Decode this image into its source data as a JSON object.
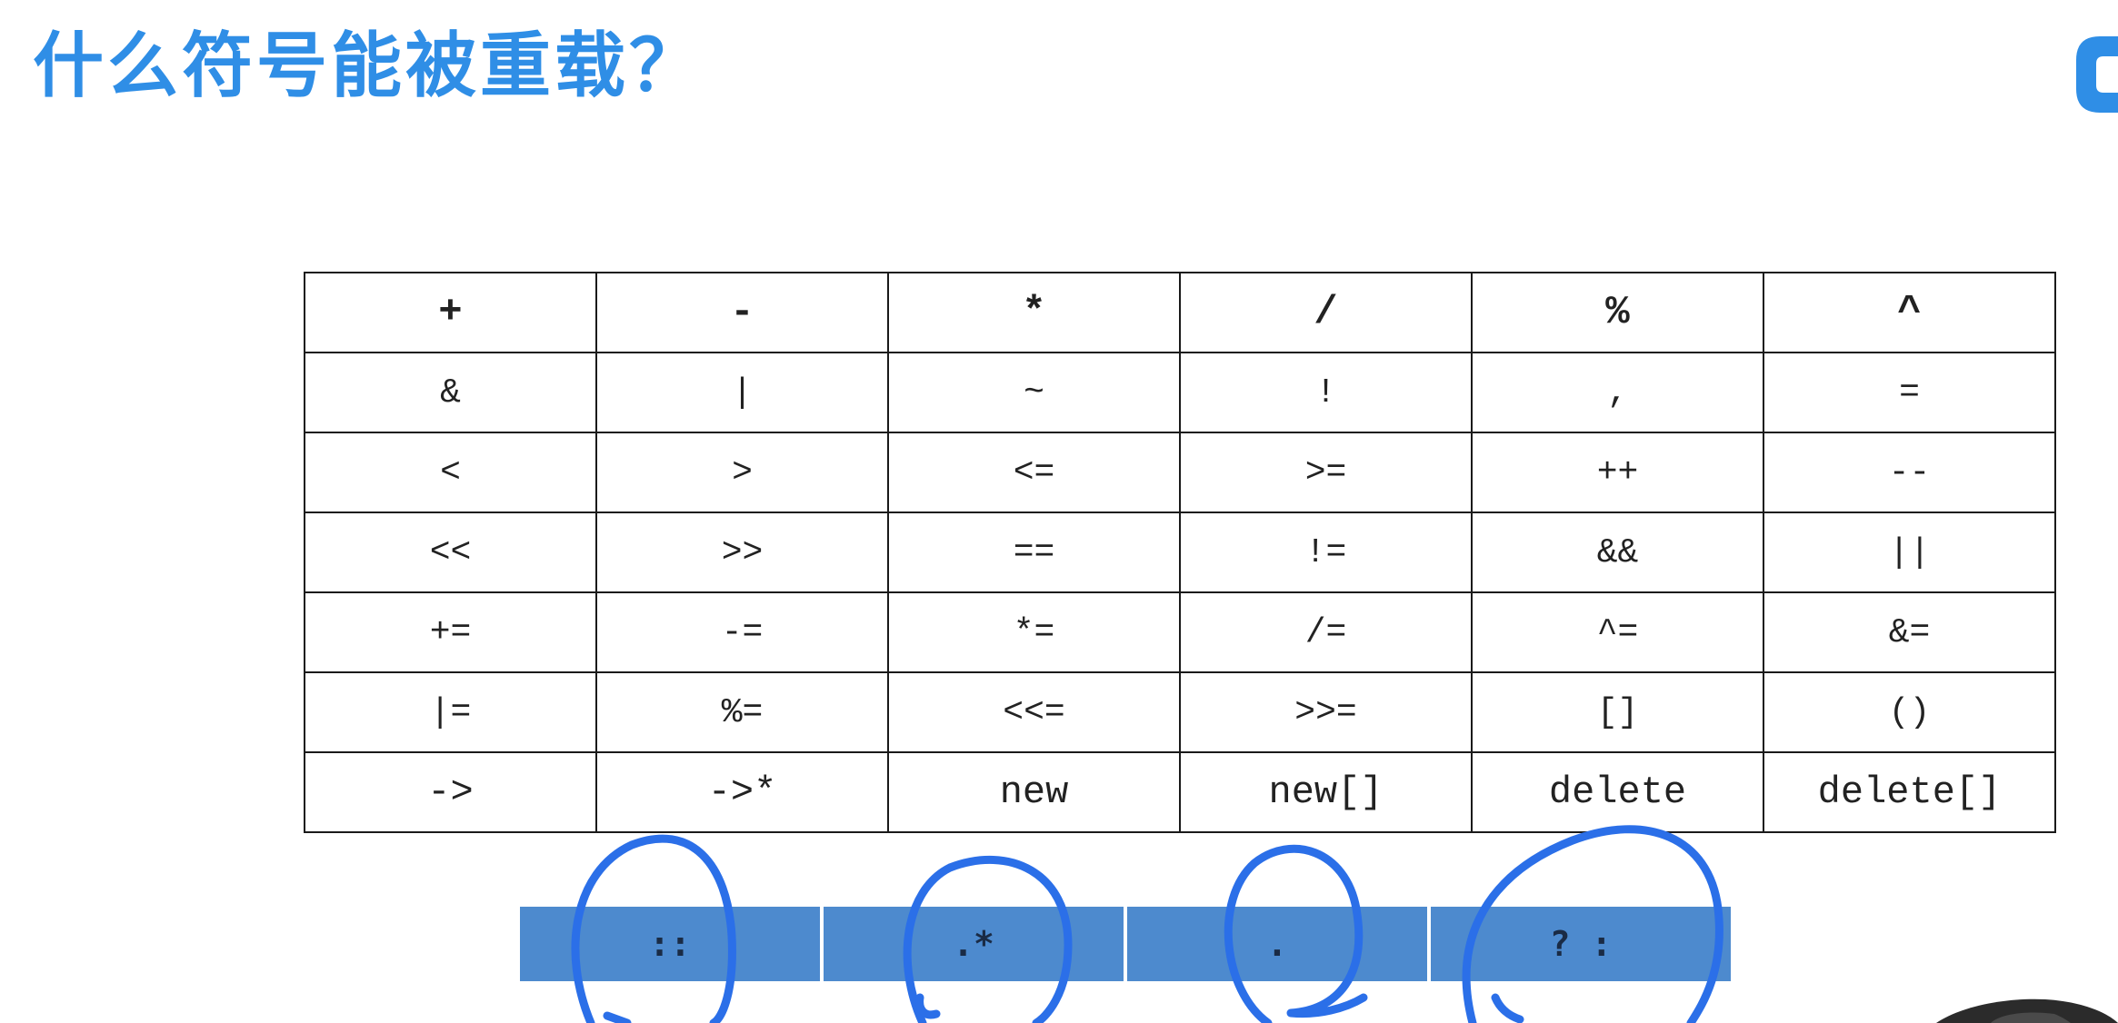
{
  "slide": {
    "title": "什么符号能被重载？",
    "accent_color": "#2f8ee6",
    "logo_icon": "brand-logo-icon"
  },
  "overloadable_operators": [
    [
      "+",
      "-",
      "*",
      "/",
      "%",
      "^"
    ],
    [
      "&",
      "|",
      "~",
      "!",
      ",",
      "="
    ],
    [
      "<",
      ">",
      "<=",
      ">=",
      "++",
      "--"
    ],
    [
      "<<",
      ">>",
      "==",
      "!=",
      "&&",
      "||"
    ],
    [
      "+=",
      "-=",
      "*=",
      "/=",
      "^=",
      "&="
    ],
    [
      "|=",
      "%=",
      "<<=",
      ">>=",
      "[]",
      "()"
    ],
    [
      "->",
      "->*",
      "new",
      "new[]",
      "delete",
      "delete[]"
    ]
  ],
  "non_overloadable_operators": {
    "cells": [
      "::",
      ".*",
      ".",
      "? :"
    ],
    "fill_color": "#4d8ace",
    "annotation_color": "#2b6fe8"
  }
}
